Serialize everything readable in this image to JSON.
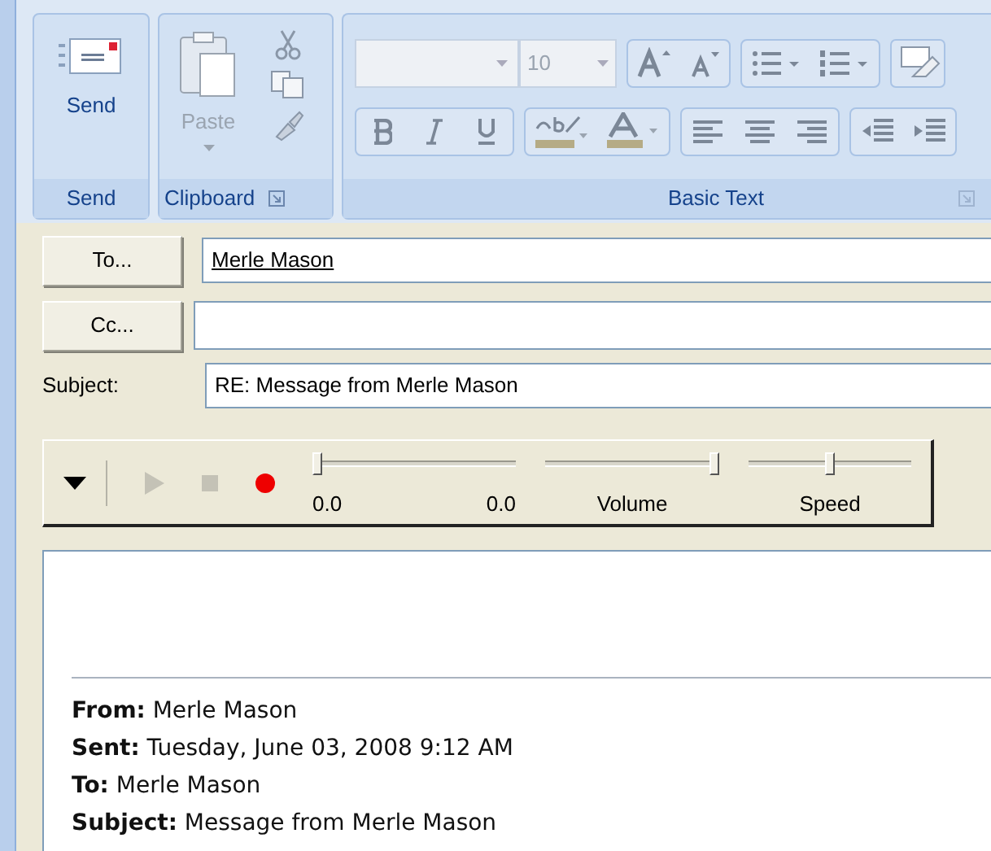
{
  "ribbon": {
    "send_group": {
      "label": "Send",
      "button": "Send"
    },
    "clipboard_group": {
      "label": "Clipboard",
      "paste": {
        "label": "Paste",
        "disabled": true
      }
    },
    "basic_text_group": {
      "label": "Basic Text",
      "font_size": "10"
    }
  },
  "to_button": "To...",
  "to_field": {
    "value": "Merle Mason"
  },
  "cc_button": "Cc...",
  "subject": {
    "label": "Subject:",
    "value": "RE: Message from Merle Mason"
  },
  "player": {
    "buttons": [
      {
        "kind": "menu",
        "disabled": false
      },
      {
        "kind": "play",
        "disabled": true
      },
      {
        "kind": "stop",
        "disabled": true
      },
      {
        "kind": "record",
        "disabled": false
      }
    ],
    "sliders": [
      {
        "kind": "position",
        "level": 0,
        "labels": [
          "0.0",
          "0.0"
        ]
      },
      {
        "kind": "volume",
        "level": 1,
        "labels": [
          "Volume"
        ]
      },
      {
        "kind": "speed",
        "level": 0.5,
        "labels": [
          "Speed"
        ]
      }
    ]
  },
  "body": {
    "quoted_header": [
      "**From:** Merle Mason",
      "**Sent:** Tuesday, June 03, 2008 9:12 AM",
      "**To:** Merle Mason",
      "**Subject:** Message from Merle Mason"
    ]
  }
}
